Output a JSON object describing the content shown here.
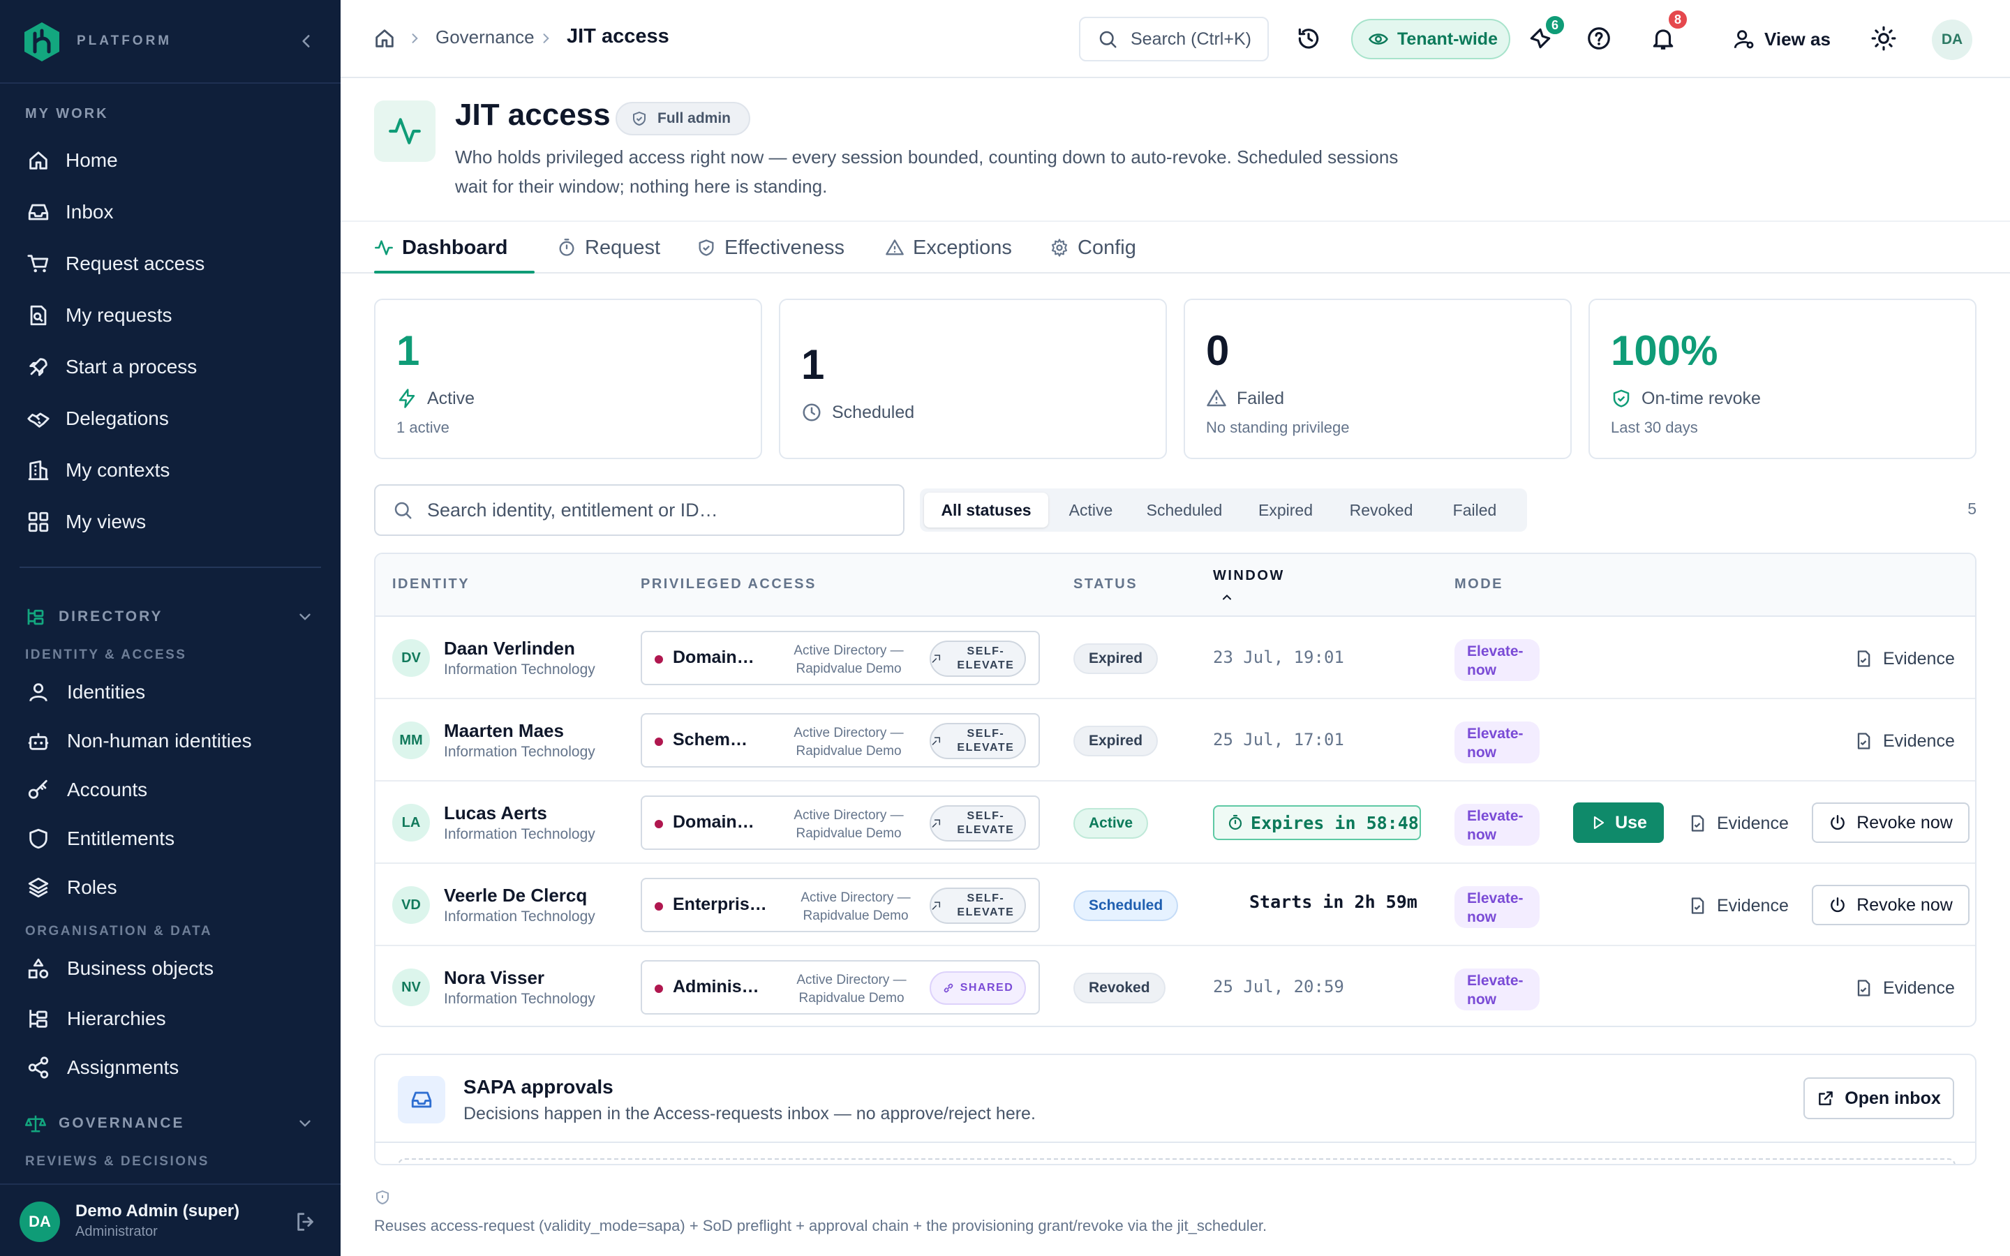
{
  "sidebar": {
    "brand": "PLATFORM",
    "my_work_label": "MY WORK",
    "my_work": [
      {
        "label": "Home",
        "icon": "home-icon"
      },
      {
        "label": "Inbox",
        "icon": "inbox-icon"
      },
      {
        "label": "Request access",
        "icon": "cart-icon"
      },
      {
        "label": "My requests",
        "icon": "requests-icon"
      },
      {
        "label": "Start a process",
        "icon": "rocket-icon"
      },
      {
        "label": "Delegations",
        "icon": "handshake-icon"
      },
      {
        "label": "My contexts",
        "icon": "building-icon"
      },
      {
        "label": "My views",
        "icon": "grid-icon"
      }
    ],
    "directory_label": "DIRECTORY",
    "identity_access_label": "IDENTITY & ACCESS",
    "identity_access": [
      {
        "label": "Identities",
        "icon": "user-icon"
      },
      {
        "label": "Non-human identities",
        "icon": "bot-icon"
      },
      {
        "label": "Accounts",
        "icon": "key-icon"
      },
      {
        "label": "Entitlements",
        "icon": "shield-icon"
      },
      {
        "label": "Roles",
        "icon": "layers-icon"
      }
    ],
    "org_data_label": "ORGANISATION & DATA",
    "org_data": [
      {
        "label": "Business objects",
        "icon": "shapes-icon"
      },
      {
        "label": "Hierarchies",
        "icon": "hierarchy-icon"
      },
      {
        "label": "Assignments",
        "icon": "share-icon"
      }
    ],
    "governance_label": "GOVERNANCE",
    "reviews_label": "REVIEWS & DECISIONS",
    "user": {
      "initials": "DA",
      "name": "Demo Admin (super)",
      "role": "Administrator"
    }
  },
  "topbar": {
    "breadcrumb": [
      "Governance",
      "JIT access"
    ],
    "search_label": "Search (Ctrl+K)",
    "tenant_label": "Tenant-wide",
    "activity_badge": "6",
    "notifications_badge": "8",
    "view_as_label": "View as",
    "avatar_initials": "DA"
  },
  "page": {
    "title": "JIT access",
    "badge": "Full admin",
    "description": "Who holds privileged access right now — every session bounded, counting down to auto-revoke. Scheduled sessions wait for their window; nothing here is standing."
  },
  "tabs": [
    {
      "label": "Dashboard",
      "icon": "activity-icon",
      "active": true
    },
    {
      "label": "Request",
      "icon": "timer-icon"
    },
    {
      "label": "Effectiveness",
      "icon": "shield-check-icon"
    },
    {
      "label": "Exceptions",
      "icon": "warning-icon"
    },
    {
      "label": "Config",
      "icon": "gear-icon"
    }
  ],
  "stats": [
    {
      "value": "1",
      "label": "Active",
      "sub": "1 active",
      "icon": "bolt-icon",
      "accent": "#0f9c77"
    },
    {
      "value": "1",
      "label": "Scheduled",
      "sub": "",
      "icon": "clock-icon"
    },
    {
      "value": "0",
      "label": "Failed",
      "sub": "No standing privilege",
      "icon": "warning-icon"
    },
    {
      "value": "100%",
      "label": "On-time revoke",
      "sub": "Last 30 days",
      "icon": "shield-check-icon",
      "accent": "#0f9c77"
    }
  ],
  "filters": {
    "search_placeholder": "Search identity, entitlement or ID…",
    "statuses": [
      "All statuses",
      "Active",
      "Scheduled",
      "Expired",
      "Revoked",
      "Failed"
    ],
    "selected": "All statuses",
    "count": "5"
  },
  "table": {
    "columns": [
      "IDENTITY",
      "PRIVILEGED ACCESS",
      "STATUS",
      "WINDOW",
      "MODE"
    ],
    "rows": [
      {
        "initials": "DV",
        "name": "Daan Verlinden",
        "dept": "Information Technology",
        "entitlement": "Domain Admins",
        "source": "Active Directory — Rapidvalue Demo",
        "tag": "SELF-ELEVATE",
        "status": "Expired",
        "window": "23 Jul, 19:01",
        "mode": "Elevate-now",
        "evidence": "Evidence"
      },
      {
        "initials": "MM",
        "name": "Maarten Maes",
        "dept": "Information Technology",
        "entitlement": "Schema Admins",
        "source": "Active Directory — Rapidvalue Demo",
        "tag": "SELF-ELEVATE",
        "status": "Expired",
        "window": "25 Jul, 17:01",
        "mode": "Elevate-now",
        "evidence": "Evidence"
      },
      {
        "initials": "LA",
        "name": "Lucas Aerts",
        "dept": "Information Technology",
        "entitlement": "Domain Admins",
        "source": "Active Directory — Rapidvalue Demo",
        "tag": "SELF-ELEVATE",
        "status": "Active",
        "window": "Expires in 58:48",
        "mode": "Elevate-now",
        "use": "Use",
        "evidence": "Evidence",
        "revoke": "Revoke now"
      },
      {
        "initials": "VD",
        "name": "Veerle De Clercq",
        "dept": "Information Technology",
        "entitlement": "Enterprise Admins",
        "source": "Active Directory — Rapidvalue Demo",
        "tag": "SELF-ELEVATE",
        "status": "Scheduled",
        "window": "Starts in 2h 59m",
        "mode": "Elevate-now",
        "evidence": "Evidence",
        "revoke": "Revoke now"
      },
      {
        "initials": "NV",
        "name": "Nora Visser",
        "dept": "Information Technology",
        "entitlement": "Administrators",
        "source": "Active Directory — Rapidvalue Demo",
        "tag": "SHARED",
        "status": "Revoked",
        "window": "25 Jul, 20:59",
        "mode": "Elevate-now",
        "evidence": "Evidence"
      }
    ]
  },
  "sapa": {
    "title": "SAPA approvals",
    "description": "Decisions happen in the Access-requests inbox — no approve/reject here.",
    "open_label": "Open inbox"
  },
  "footer": "Reuses access-request (validity_mode=sapa) + SoD preflight + approval chain + the provisioning grant/revoke via the jit_scheduler."
}
